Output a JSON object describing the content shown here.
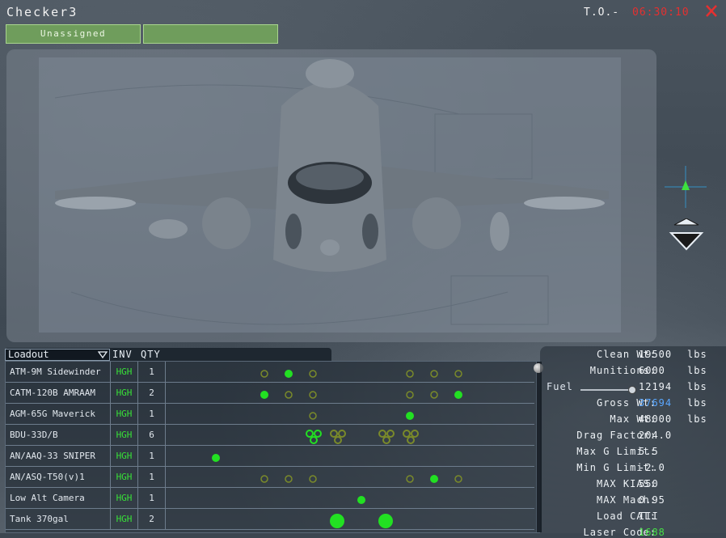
{
  "window": {
    "title": "Checker3",
    "to_label": "T.O.-",
    "to_time": "06:30:10"
  },
  "flight_buttons": [
    {
      "label": "Unassigned"
    },
    {
      "label": ""
    }
  ],
  "loadout": {
    "selector_label": "Loadout",
    "columns": {
      "inv": "INV",
      "qty": "QTY"
    },
    "rows": [
      {
        "name": "ATM-9M Sidewinder",
        "inv": "HGH",
        "qty": "1"
      },
      {
        "name": "CATM-120B AMRAAM",
        "inv": "HGH",
        "qty": "2"
      },
      {
        "name": "AGM-65G Maverick",
        "inv": "HGH",
        "qty": "1"
      },
      {
        "name": "BDU-33D/B",
        "inv": "HGH",
        "qty": "6"
      },
      {
        "name": "AN/AAQ-33 SNIPER",
        "inv": "HGH",
        "qty": "1"
      },
      {
        "name": "AN/ASQ-T50(v)1",
        "inv": "HGH",
        "qty": "1"
      },
      {
        "name": "Low Alt Camera",
        "inv": "HGH",
        "qty": "1"
      },
      {
        "name": "Tank 370gal",
        "inv": "HGH",
        "qty": "2"
      }
    ]
  },
  "stats": {
    "clean_wt": {
      "label": "Clean Wt:",
      "value": "19500",
      "unit": "lbs"
    },
    "munitions": {
      "label": "Munitions:",
      "value": "6000",
      "unit": "lbs"
    },
    "fuel": {
      "label": "Fuel",
      "value": "12194",
      "unit": "lbs"
    },
    "gross_wt": {
      "label": "Gross Wt:",
      "value": "37694",
      "unit": "lbs"
    },
    "max_wt": {
      "label": "Max Wt:",
      "value": "48000",
      "unit": "lbs"
    },
    "drag_factor": {
      "label": "Drag Factor:",
      "value": "204.0"
    },
    "max_g": {
      "label": "Max G Limit:",
      "value": "5.5"
    },
    "min_g": {
      "label": "Min G Limit:",
      "value": "-2.0"
    },
    "max_kias": {
      "label": "MAX KIAS:",
      "value": "550"
    },
    "max_mach": {
      "label": "MAX Mach:",
      "value": "0.95"
    },
    "load_cat": {
      "label": "Load CAT:",
      "value": "III"
    },
    "laser_code": {
      "label": "Laser Code:",
      "value": "1688"
    }
  },
  "colors": {
    "accent_green": "#38e038",
    "hardpoint_dim": "#7a8a2a",
    "to_time_red": "#e53030",
    "gross_blue": "#5aa7ff"
  },
  "icons": {
    "close": "close-icon",
    "crosshair": "crosshair-icon",
    "down": "down-arrow-icon",
    "dropdown": "chevron-down-icon"
  }
}
